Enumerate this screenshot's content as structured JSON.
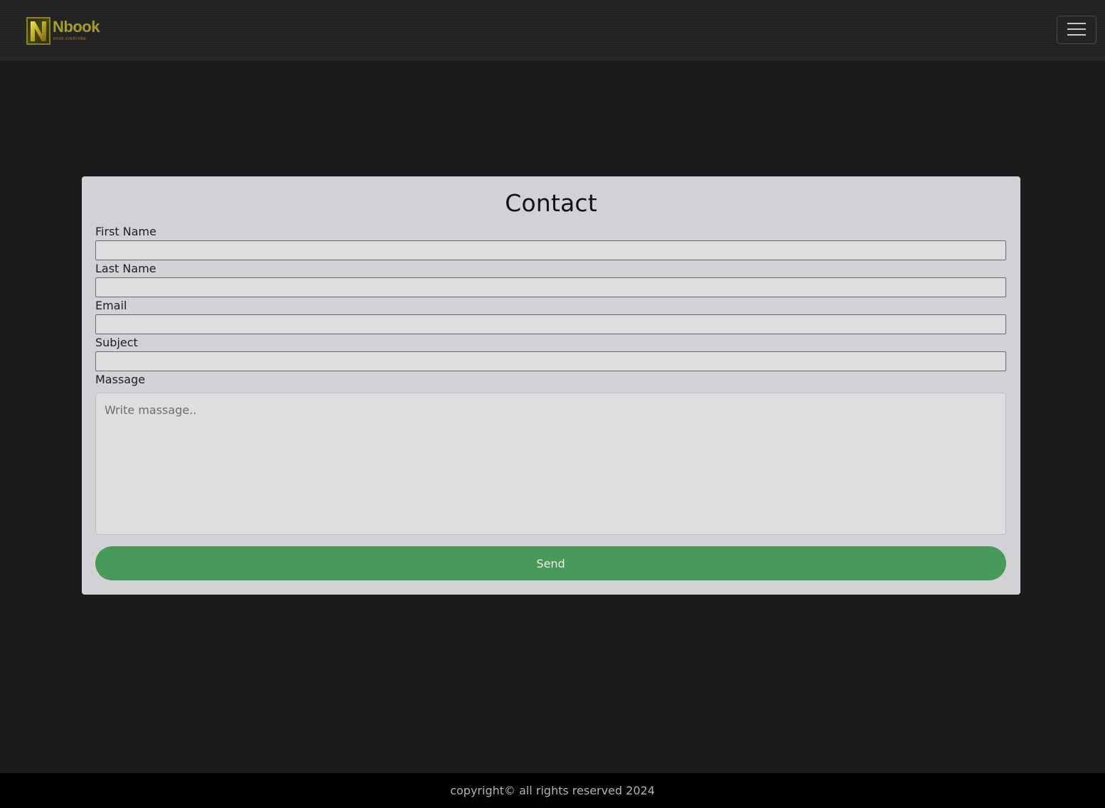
{
  "navbar": {
    "brand_name": "Nbook",
    "brand_tagline": "BOOK EVERYONE",
    "brand_letter": "N",
    "toggle_icon": "hamburger-menu-icon"
  },
  "contact": {
    "title": "Contact",
    "fields": {
      "first_name": {
        "label": "First Name",
        "value": ""
      },
      "last_name": {
        "label": "Last Name",
        "value": ""
      },
      "email": {
        "label": "Email",
        "value": ""
      },
      "subject": {
        "label": "Subject",
        "value": ""
      },
      "message": {
        "label": "Massage",
        "placeholder": "Write massage..",
        "value": ""
      }
    },
    "send_label": "Send"
  },
  "footer": {
    "text": "copyright© all rights reserved 2024"
  },
  "colors": {
    "page_bg": "#1b1b1b",
    "card_bg": "#d2d2d4",
    "send_button": "#479a5a",
    "brand_gold": "#a79e2a",
    "footer_bg": "#000000"
  }
}
